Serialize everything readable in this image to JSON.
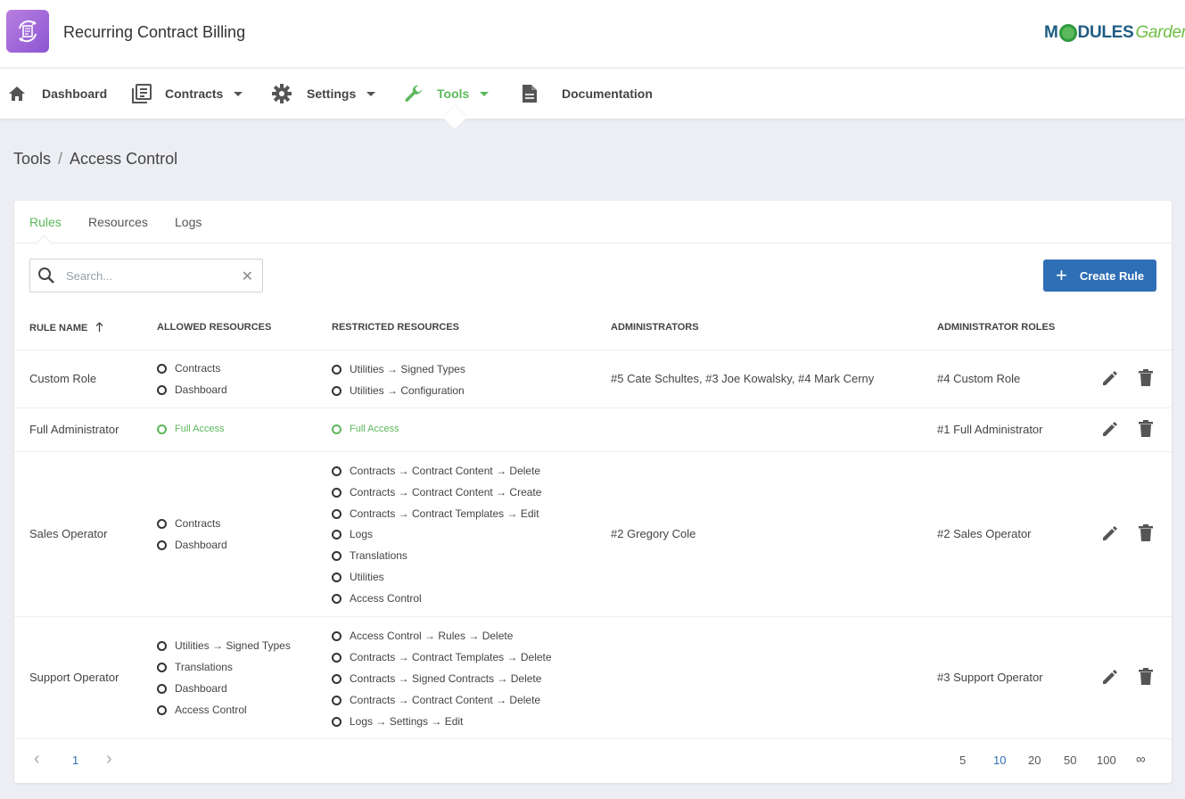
{
  "app": {
    "title": "Recurring Contract Billing"
  },
  "logo": {
    "part1": "M",
    "part2": "DULES",
    "part3": "Garden"
  },
  "nav": {
    "dashboard": "Dashboard",
    "contracts": "Contracts",
    "settings": "Settings",
    "tools": "Tools",
    "documentation": "Documentation"
  },
  "breadcrumb": {
    "parent": "Tools",
    "separator": "/",
    "current": "Access Control"
  },
  "tabs": {
    "rules": "Rules",
    "resources": "Resources",
    "logs": "Logs"
  },
  "search": {
    "placeholder": "Search...",
    "clear": "✕"
  },
  "create_button": {
    "label": "Create Rule"
  },
  "columns": {
    "rule_name": "RULE NAME",
    "allowed": "ALLOWED RESOURCES",
    "restricted": "RESTRICTED RESOURCES",
    "administrators": "ADMINISTRATORS",
    "admin_roles": "ADMINISTRATOR ROLES"
  },
  "rows": [
    {
      "name": "Custom Role",
      "allowed": [
        "Contracts",
        "Dashboard"
      ],
      "restricted": [
        "Utilities → Signed Types",
        "Utilities → Configuration"
      ],
      "administrators": "#5 Cate Schultes, #3 Joe Kowalsky, #4 Mark Cerny",
      "roles": "#4 Custom Role"
    },
    {
      "name": "Full Administrator",
      "allowed": [
        "Full Access"
      ],
      "restricted": [
        "Full Access"
      ],
      "administrators": "",
      "roles": "#1 Full Administrator"
    },
    {
      "name": "Sales Operator",
      "allowed": [
        "Contracts",
        "Dashboard"
      ],
      "restricted": [
        "Contracts → Contract Content → Delete",
        "Contracts → Contract Content → Create",
        "Contracts → Contract Templates → Edit",
        "Logs",
        "Translations",
        "Utilities",
        "Access Control"
      ],
      "administrators": "#2 Gregory Cole",
      "roles": "#2 Sales Operator"
    },
    {
      "name": "Support Operator",
      "allowed": [
        "Utilities → Signed Types",
        "Translations",
        "Dashboard",
        "Access Control"
      ],
      "restricted": [
        "Access Control → Rules → Delete",
        "Contracts → Contract Templates → Delete",
        "Contracts → Signed Contracts → Delete",
        "Contracts → Contract Content → Delete",
        "Logs → Settings → Edit"
      ],
      "administrators": "",
      "roles": "#3 Support Operator"
    }
  ],
  "pagination": {
    "prev": "‹",
    "page": "1",
    "next": "›",
    "sizes": [
      "5",
      "10",
      "20",
      "50",
      "100",
      "∞"
    ],
    "selected_size": "10"
  },
  "colors": {
    "accent": "#5cb85c",
    "primary": "#2f6fb6",
    "app_icon": "#9b65d8"
  }
}
